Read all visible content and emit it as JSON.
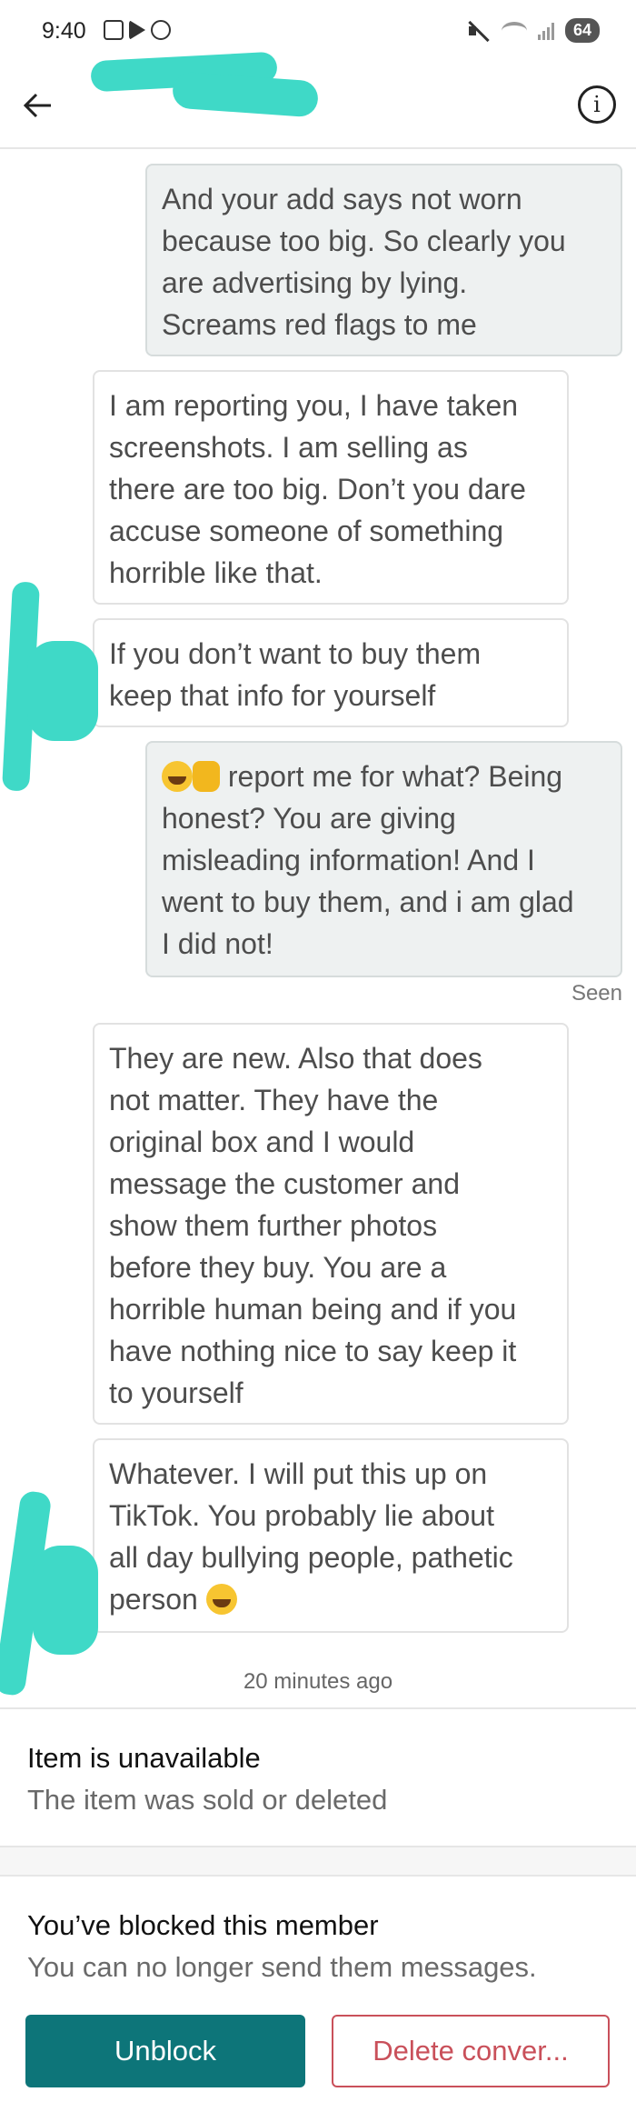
{
  "status_bar": {
    "time": "9:40",
    "battery": "64"
  },
  "header": {
    "back_icon": "arrow-left-icon",
    "info_icon": "info-icon",
    "info_glyph": "i"
  },
  "messages": [
    {
      "direction": "out",
      "text": "And your add says not worn\nbecause too big. So clearly you\nare advertising by lying.\nScreams red flags to me"
    },
    {
      "direction": "in",
      "text": "I am reporting you, I have taken\nscreenshots. I am selling as\nthere are too big. Don’t you dare\naccuse someone of something\nhorrible like that."
    },
    {
      "direction": "in",
      "text": "If you don’t want to buy them\nkeep that info for yourself"
    },
    {
      "direction": "out",
      "text_after_emoji": " report me for what? Being\nhonest? You are giving\nmisleading information! And I\nwent to buy them, and i am glad\nI did not!"
    },
    {
      "direction": "in",
      "text": "They are new. Also that does\nnot matter. They have the\noriginal box and I would\nmessage the customer and\nshow them further photos\nbefore they buy. You are a\nhorrible human being and if you\nhave nothing nice to say keep it\nto yourself"
    },
    {
      "direction": "in",
      "text_before_emoji": "Whatever. I will put this up on\nTikTok. You probably lie about\nall day bullying people, pathetic\nperson "
    }
  ],
  "seen_label": "Seen",
  "timestamp": "20 minutes ago",
  "item_panel": {
    "title": "Item is unavailable",
    "subtitle": "The item was sold or deleted"
  },
  "blocked_panel": {
    "title": "You’ve blocked this member",
    "subtitle": "You can no longer send them messages."
  },
  "buttons": {
    "unblock": "Unblock",
    "delete": "Delete conver..."
  },
  "colors": {
    "accent": "#0d7579",
    "danger": "#c9505a",
    "redaction": "#3fd9c7"
  }
}
